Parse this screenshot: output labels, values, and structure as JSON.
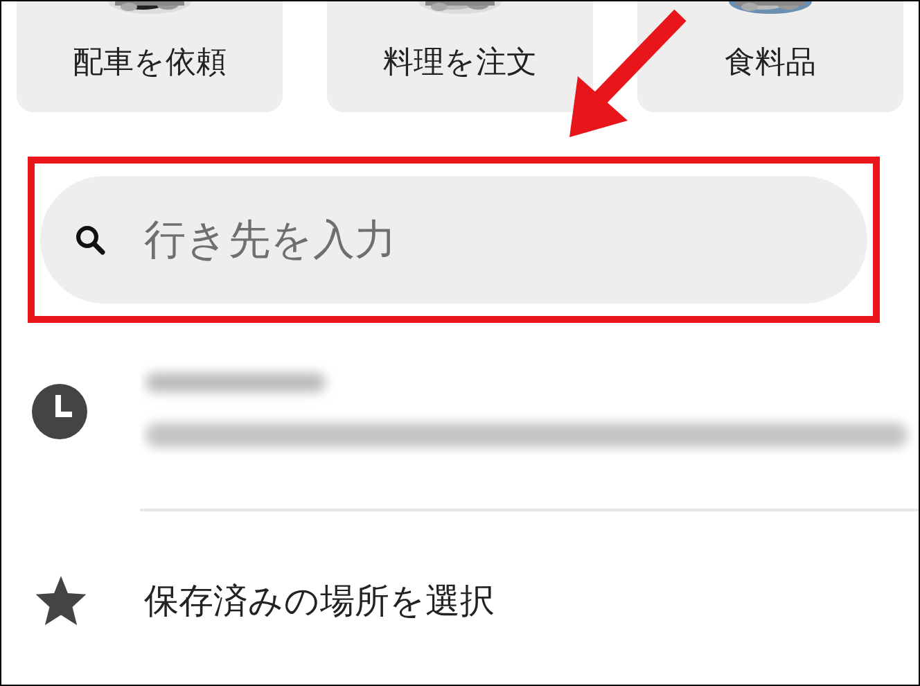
{
  "shortcuts": [
    {
      "label": "配車を依頼"
    },
    {
      "label": "料理を注文"
    },
    {
      "label": "食料品"
    }
  ],
  "search": {
    "placeholder": "行き先を入力"
  },
  "saved_places": {
    "label": "保存済みの場所を選択"
  }
}
